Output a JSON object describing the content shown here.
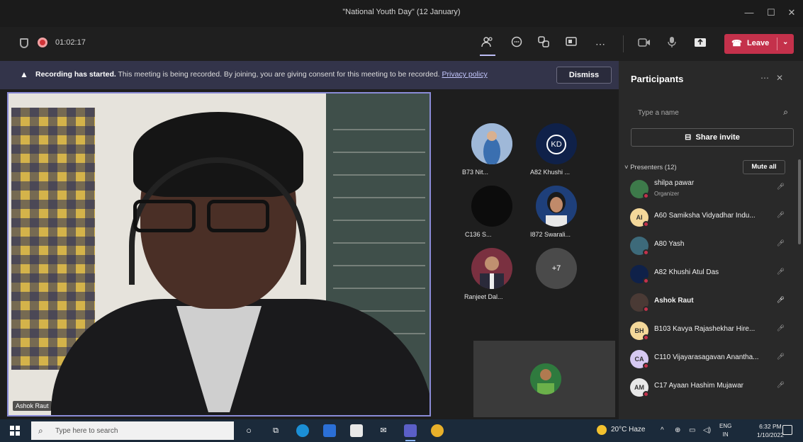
{
  "window": {
    "title": "\"National Youth Day\" (12 January)",
    "minimize": "—",
    "maximize": "☐",
    "close": "✕"
  },
  "meeting": {
    "timer": "01:02:17",
    "leave_label": "Leave"
  },
  "banner": {
    "bold": "Recording has started.",
    "text": " This meeting is being recorded. By joining, you are giving consent for this meeting to be recorded. ",
    "link": "Privacy policy",
    "dismiss": "Dismiss"
  },
  "stage": {
    "main_speaker_label": "Ashok Raut",
    "gallery": [
      {
        "label": "B73 Nit..."
      },
      {
        "label": "A82 Khushi ..."
      },
      {
        "label": "C136 S..."
      },
      {
        "label": "I872 Swarali..."
      },
      {
        "label": "Ranjeet Dal..."
      },
      {
        "label": "+7"
      }
    ],
    "kd_initials": "KD"
  },
  "participants": {
    "title": "Participants",
    "search_placeholder": "Type a name",
    "share_invite": "Share invite",
    "section": "Presenters (12)",
    "mute_all": "Mute all",
    "rows": [
      {
        "name": "shilpa pawar",
        "role": "Organizer",
        "initials": "",
        "avatar_color": "#3d7a4a",
        "dot_color": "#c4314b"
      },
      {
        "name": "A60 Samiksha Vidyadhar Indu...",
        "role": "",
        "initials": "AI",
        "avatar_color": "#f4d89a",
        "dot_color": "#c4314b"
      },
      {
        "name": "A80 Yash",
        "role": "",
        "initials": "",
        "avatar_color": "#3d6a7a",
        "dot_color": "#c4314b"
      },
      {
        "name": "A82 Khushi Atul Das",
        "role": "",
        "initials": "",
        "avatar_color": "#0f2149",
        "dot_color": "#c4314b"
      },
      {
        "name": "Ashok Raut",
        "role": "",
        "initials": "",
        "avatar_color": "#4a3a35",
        "dot_color": "#c4314b"
      },
      {
        "name": "B103 Kavya Rajashekhar Hire...",
        "role": "",
        "initials": "BH",
        "avatar_color": "#f4d89a",
        "dot_color": "#c4314b"
      },
      {
        "name": "C110 Vijayarasagavan Anantha...",
        "role": "",
        "initials": "CA",
        "avatar_color": "#d6c9f2",
        "dot_color": "#c4314b"
      },
      {
        "name": "C17 Ayaan Hashim Mujawar",
        "role": "",
        "initials": "AM",
        "avatar_color": "#e8e8e8",
        "dot_color": "#c4314b"
      }
    ]
  },
  "taskbar": {
    "search_placeholder": "Type here to search",
    "weather": "20°C  Haze",
    "lang_top": "ENG",
    "lang_bottom": "IN",
    "time": "6:32 PM",
    "date": "1/10/2022"
  },
  "colors": {
    "accent": "#8a8bd6",
    "leave": "#c4314b",
    "banner": "#33344a"
  }
}
